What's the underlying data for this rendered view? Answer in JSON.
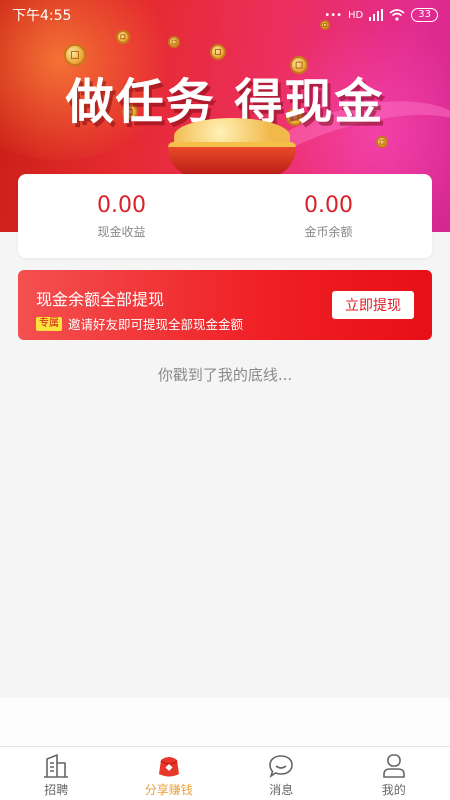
{
  "status_bar": {
    "time": "下午4:55",
    "network": "HD",
    "battery": "33"
  },
  "hero": {
    "title": "做任务 得现金"
  },
  "stats": [
    {
      "value": "0.00",
      "label": "现金收益"
    },
    {
      "value": "0.00",
      "label": "金币余额"
    }
  ],
  "withdraw": {
    "title": "现金余额全部提现",
    "tag": "专属",
    "subtitle": "邀请好友即可提现全部现金金额",
    "button_label": "立即提现"
  },
  "end_of_list": "你戳到了我的底线...",
  "tabs": [
    {
      "label": "招聘",
      "icon": "building-icon",
      "active": false
    },
    {
      "label": "分享赚钱",
      "icon": "red-envelope-icon",
      "active": true
    },
    {
      "label": "消息",
      "icon": "chat-bubble-icon",
      "active": false
    },
    {
      "label": "我的",
      "icon": "person-icon",
      "active": false
    }
  ],
  "colors": {
    "accent_red": "#d8222a",
    "tab_active": "#e8a23a",
    "banner_red": "#ef1f24"
  }
}
